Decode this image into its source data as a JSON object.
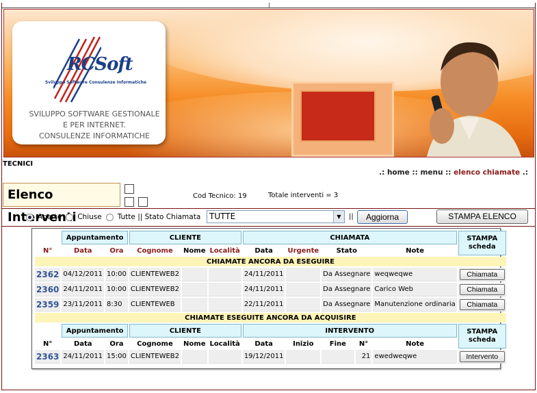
{
  "banner": {
    "logo_mark": "RCSoft",
    "logo_tagline": "Sviluppo Software Consulenze Informatiche",
    "logo_lines": [
      "SVILUPPO SOFTWARE GESTIONALE",
      "E PER INTERNET.",
      "CONSULENZE INFORMATICHE"
    ]
  },
  "section_label": "TECNICI",
  "nav": {
    "prefix": ".:",
    "home": "home",
    "sep1": "::",
    "menu": "menu",
    "sep2": "::",
    "current": "elenco chiamate",
    "suffix": ".:"
  },
  "page_title": "Elenco Interventi",
  "cod_tecnico": "Cod Tecnico: 19",
  "totale": "Totale interventi = 3",
  "filters": {
    "aperte": "Aperte",
    "chiuse": "Chiuse",
    "tutte": "Tutte || Stato Chiamata",
    "select_value": "TUTTE",
    "pipes": "||",
    "aggiorna": "Aggiorna",
    "stampa_elenco": "STAMPA ELENCO",
    "selected_radio": "Aperte"
  },
  "table1": {
    "groups": {
      "appuntamento": "Appuntamento",
      "cliente": "CLIENTE",
      "chiamata": "CHIAMATA",
      "stampa": "STAMPA",
      "scheda": "scheda"
    },
    "cols": {
      "n": "N°",
      "data": "Data",
      "ora": "Ora",
      "cognome": "Cognome",
      "nome": "Nome",
      "localita": "Località",
      "cdata": "Data",
      "urgente": "Urgente",
      "stato": "Stato",
      "note": "Note"
    },
    "section": "CHIAMATE ANCORA DA ESEGUIRE",
    "rows": [
      {
        "n": "2362",
        "data": "04/12/2011",
        "ora": "10:00",
        "cognome": "CLIENTEWEB2",
        "nome": "",
        "localita": "",
        "cdata": "24/11/2011",
        "urgente": "",
        "stato": "Da Assegnare",
        "note": "weqweqwe",
        "button": "Chiamata"
      },
      {
        "n": "2360",
        "data": "24/11/2011",
        "ora": "10:00",
        "cognome": "CLIENTEWEB2",
        "nome": "",
        "localita": "",
        "cdata": "24/11/2011",
        "urgente": "",
        "stato": "Da Assegnare",
        "note": "Carico Web",
        "button": "Chiamata"
      },
      {
        "n": "2359",
        "data": "23/11/2011",
        "ora": "8:30",
        "cognome": "CLIENTEWEB",
        "nome": "",
        "localita": "",
        "cdata": "22/11/2011",
        "urgente": "",
        "stato": "Da Assegnare",
        "note": "Manutenzione ordinaria",
        "button": "Chiamata"
      }
    ]
  },
  "table2": {
    "section": "CHIAMATE ESEGUITE ANCORA DA ACQUISIRE",
    "groups": {
      "appuntamento": "Appuntamento",
      "cliente": "CLIENTE",
      "intervento": "INTERVENTO",
      "stampa": "STAMPA",
      "scheda": "scheda"
    },
    "cols": {
      "n": "N°",
      "data": "Data",
      "ora": "Ora",
      "cognome": "Cognome",
      "nome": "Nome",
      "localita": "Località",
      "idata": "Data",
      "inizio": "Inizio",
      "fine": "Fine",
      "num": "N°",
      "note": "Note"
    },
    "rows": [
      {
        "n": "2363",
        "data": "24/11/2011",
        "ora": "15:00",
        "cognome": "CLIENTEWEB2",
        "nome": "",
        "localita": "",
        "idata": "19/12/2011",
        "inizio": "",
        "fine": "",
        "num": "21",
        "note": "ewedweqwe",
        "button": "Intervento"
      }
    ]
  }
}
